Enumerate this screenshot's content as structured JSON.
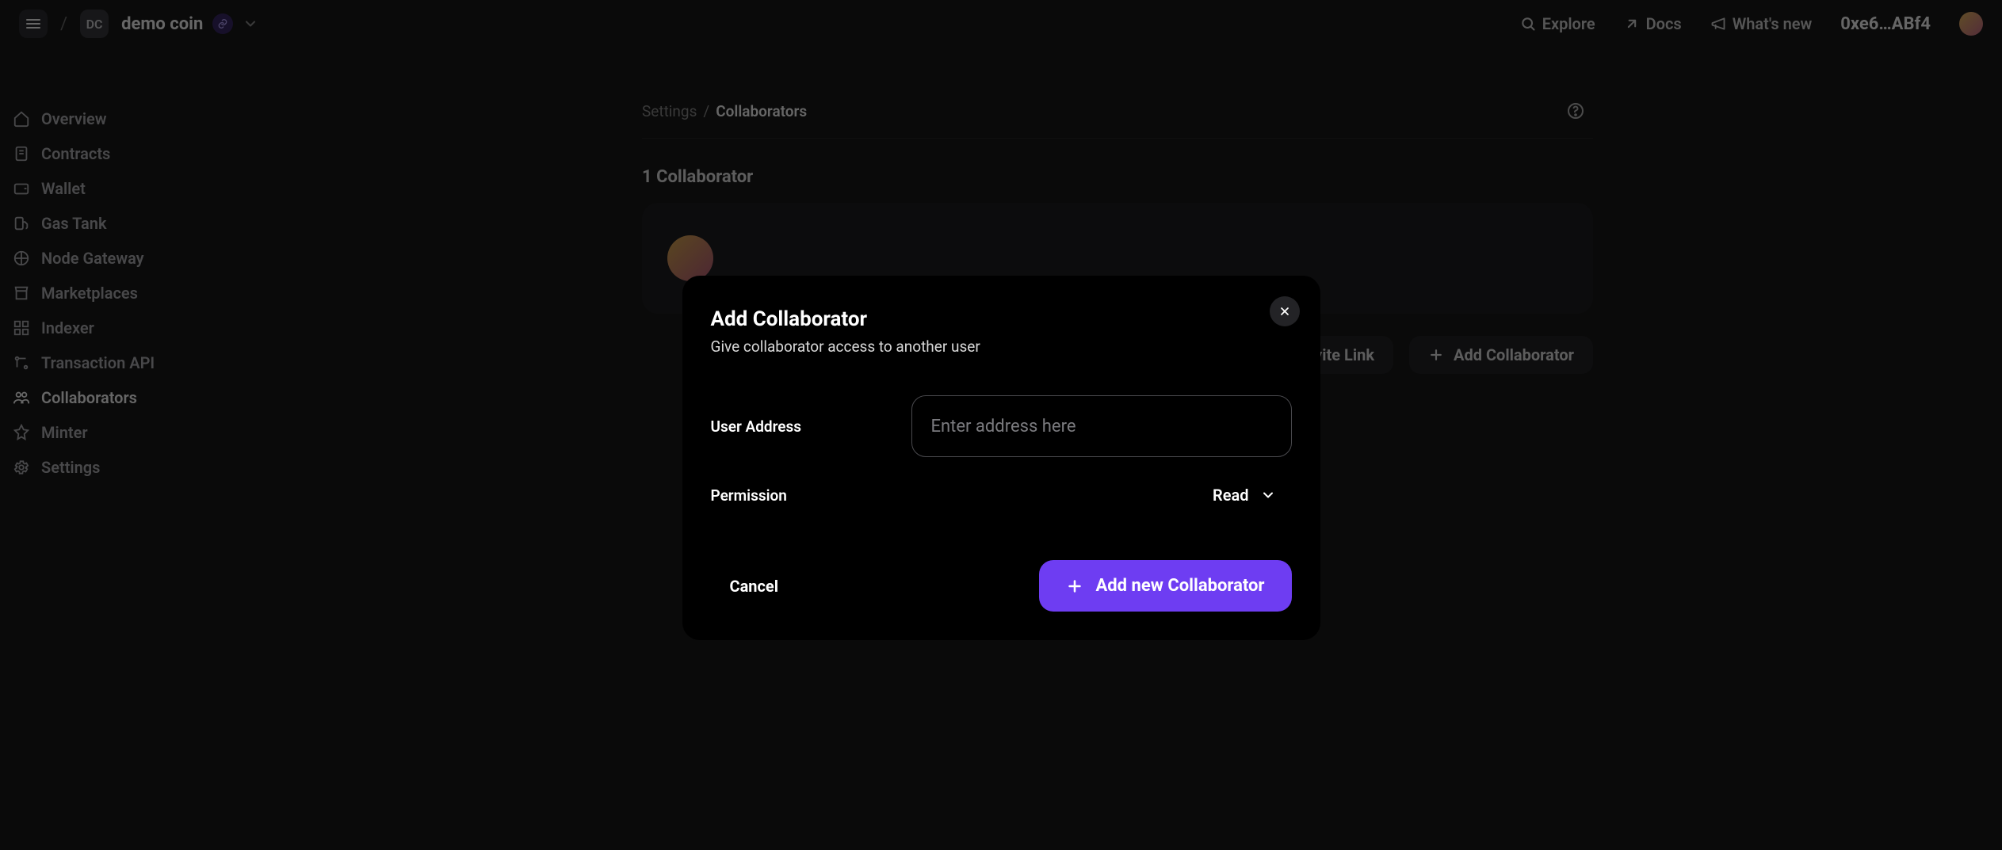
{
  "header": {
    "project_initials": "DC",
    "project_name": "demo coin",
    "explore": "Explore",
    "docs": "Docs",
    "whats_new": "What's new",
    "wallet": "0xe6…ABf4"
  },
  "sidebar": {
    "items": [
      {
        "label": "Overview",
        "icon": "home-icon"
      },
      {
        "label": "Contracts",
        "icon": "document-icon"
      },
      {
        "label": "Wallet",
        "icon": "wallet-icon"
      },
      {
        "label": "Gas Tank",
        "icon": "gas-icon"
      },
      {
        "label": "Node Gateway",
        "icon": "gateway-icon"
      },
      {
        "label": "Marketplaces",
        "icon": "store-icon"
      },
      {
        "label": "Indexer",
        "icon": "indexer-icon"
      },
      {
        "label": "Transaction API",
        "icon": "api-icon"
      },
      {
        "label": "Collaborators",
        "icon": "people-icon"
      },
      {
        "label": "Minter",
        "icon": "minter-icon"
      },
      {
        "label": "Settings",
        "icon": "gear-icon"
      }
    ],
    "active_index": 8
  },
  "breadcrumbs": {
    "parent": "Settings",
    "sep": "/",
    "current": "Collaborators"
  },
  "page": {
    "collab_count": "1 Collaborator",
    "invite_link_btn": "Invite Link",
    "add_collab_btn": "Add Collaborator"
  },
  "modal": {
    "title": "Add Collaborator",
    "subtitle": "Give collaborator access to another user",
    "user_address_label": "User Address",
    "user_address_placeholder": "Enter address here",
    "permission_label": "Permission",
    "permission_value": "Read",
    "cancel": "Cancel",
    "submit": "Add new Collaborator"
  }
}
